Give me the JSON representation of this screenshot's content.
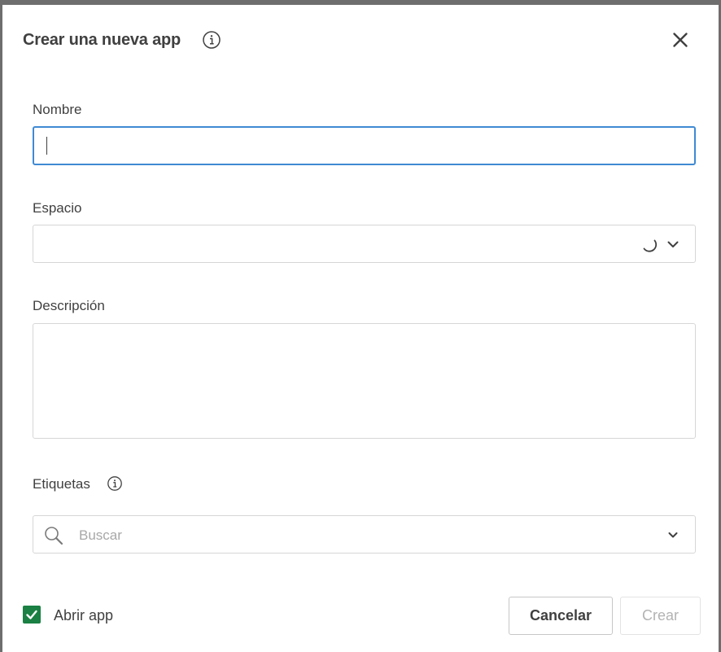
{
  "dialog": {
    "title": "Crear una nueva app",
    "title_info_icon": "info-icon",
    "close_icon": "close-icon"
  },
  "form": {
    "name": {
      "label": "Nombre",
      "value": ""
    },
    "space": {
      "label": "Espacio",
      "value": "",
      "loading_icon": "spinner-icon",
      "dropdown_icon": "chevron-down-icon"
    },
    "description": {
      "label": "Descripción",
      "value": ""
    },
    "tags": {
      "label": "Etiquetas",
      "info_icon": "info-icon",
      "search_icon": "search-icon",
      "placeholder": "Buscar",
      "dropdown_icon": "chevron-down-icon"
    }
  },
  "footer": {
    "open_app_label": "Abrir app",
    "open_app_checked": true,
    "cancel_label": "Cancelar",
    "create_label": "Crear"
  },
  "colors": {
    "focus_border": "#3f8ad3",
    "checkbox": "#1a8043",
    "text": "#404040",
    "disabled_text": "#b3b3b3"
  }
}
